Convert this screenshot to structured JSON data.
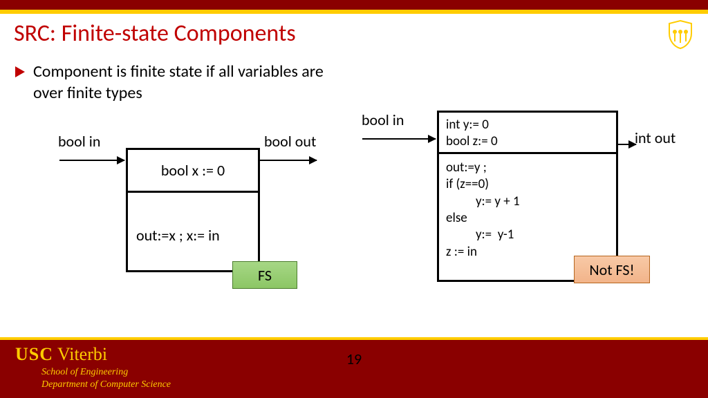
{
  "title": "SRC: Finite-state Components",
  "bullet": "Component is finite state if all variables are over finite types",
  "left": {
    "in_label": "bool in",
    "out_label": "bool out",
    "decl": "bool x := 0",
    "body": "out:=x ; x:= in",
    "badge": "FS"
  },
  "right": {
    "in_label": "bool in",
    "out_label": "int out",
    "decl1": "int y:= 0",
    "decl2": "bool z:= 0",
    "body": "out:=y ;\nif (z==0)\n          y:= y + 1\nelse\n          y:=  y-1\nz := in",
    "badge": "Not FS!"
  },
  "footer": {
    "usc": "USC",
    "viterbi": "Viterbi",
    "line1": "School of Engineering",
    "line2": "Department of  Computer Science",
    "page": "19"
  }
}
